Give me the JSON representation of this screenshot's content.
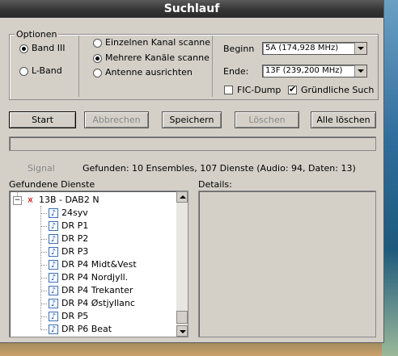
{
  "window": {
    "title": "Suchlauf"
  },
  "optionen": {
    "legend": "Optionen",
    "band3": "Band III",
    "lband": "L-Band",
    "band_selected": "Band III"
  },
  "scan_mode": {
    "single": "Einzelnen Kanal scanne",
    "multi": "Mehrere Kanäle scanne",
    "antenna": "Antenne ausrichten",
    "selected": "Mehrere Kanäle scanne"
  },
  "range": {
    "begin_label": "Beginn",
    "begin_value": "5A (174,928 MHz)",
    "end_label": "Ende:",
    "end_value": "13F (239,200 MHz)",
    "fic_dump": "FIC-Dump",
    "fic_checked": false,
    "thorough": "Gründliche Such",
    "thorough_checked": true
  },
  "buttons": {
    "start": "Start",
    "cancel": "Abbrechen",
    "save": "Speichern",
    "delete": "Löschen",
    "delete_all": "Alle löschen"
  },
  "status": {
    "signal": "Signal",
    "found": "Gefunden: 10 Ensembles, 107 Dienste (Audio: 94, Daten: 13)"
  },
  "services": {
    "label": "Gefundene Dienste",
    "ensemble": "13B - DAB2 N",
    "items": [
      "24syv",
      "DR P1",
      "DR P2",
      "DR P3",
      "DR P4 Midt&Vest",
      "DR P4 Nordjyll.",
      "DR P4 Trekanter",
      "DR P4 Østjyllanc",
      "DR P5",
      "DR P6 Beat"
    ]
  },
  "details": {
    "label": "Details:"
  },
  "colors": {
    "title_bg": "#333333",
    "window_bg": "#d4d0c8",
    "icon_blue": "#1b58b0"
  }
}
